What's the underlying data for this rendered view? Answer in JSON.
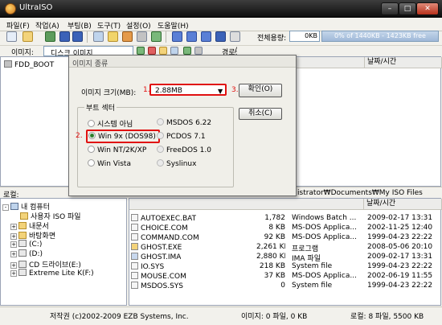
{
  "app": {
    "title": "UltraISO"
  },
  "window_buttons": {
    "min": "–",
    "max": "□",
    "close": "✕"
  },
  "menu": [
    "파일(F)",
    "작업(A)",
    "부팅(B)",
    "도구(T)",
    "설정(O)",
    "도움말(H)"
  ],
  "toolbar": {
    "capacity_label": "전체용량:",
    "capacity_value": "0KB",
    "capacity_bar_text": "0% of 1440KB - 1423KB free"
  },
  "image_row": {
    "label": "이미지:",
    "type": "디스크 이미지",
    "path_label": "경로:",
    "path_value": "/"
  },
  "upper_left": {
    "root": "FDD_BOOT"
  },
  "upper_right": {
    "col_date": "날짜/시간"
  },
  "lower_bar": {
    "label": "로컬:",
    "path": "istrator₩Documents₩My ISO Files"
  },
  "tree": [
    {
      "label": "내 컴퓨터",
      "indent": 0,
      "type": "pc",
      "expander": "-"
    },
    {
      "label": "사용자 ISO 파일",
      "indent": 1,
      "type": "folder",
      "expander": ""
    },
    {
      "label": "내문서",
      "indent": 1,
      "type": "folder",
      "expander": "+"
    },
    {
      "label": "바탕화면",
      "indent": 1,
      "type": "folder",
      "expander": "+"
    },
    {
      "label": "(C:)",
      "indent": 1,
      "type": "drive",
      "expander": "+"
    },
    {
      "label": "(D:)",
      "indent": 1,
      "type": "drive",
      "expander": "+"
    },
    {
      "label": "CD 드라이브(E:)",
      "indent": 1,
      "type": "drive",
      "expander": "+"
    },
    {
      "label": "Extreme Lite K(F:)",
      "indent": 1,
      "type": "drive",
      "expander": "+"
    }
  ],
  "files": {
    "col_date": "날짜/시간",
    "rows": [
      {
        "name": "AUTOEXEC.BAT",
        "size": "1,782",
        "type": "Windows Batch ...",
        "date": "2009-02-17 13:31"
      },
      {
        "name": "CHOICE.COM",
        "size": "8 KB",
        "type": "MS-DOS Applica...",
        "date": "2002-11-25 12:40"
      },
      {
        "name": "COMMAND.COM",
        "size": "92 KB",
        "type": "MS-DOS Applica...",
        "date": "1999-04-23 22:22"
      },
      {
        "name": "GHOST.EXE",
        "size": "2,261 KB",
        "type": "프로그램",
        "date": "2008-05-06 20:10"
      },
      {
        "name": "GHOST.IMA",
        "size": "2,880 KB",
        "type": "IMA 파일",
        "date": "2009-02-17 13:31"
      },
      {
        "name": "IO.SYS",
        "size": "218 KB",
        "type": "System file",
        "date": "1999-04-23 22:22"
      },
      {
        "name": "MOUSE.COM",
        "size": "37 KB",
        "type": "MS-DOS Applica...",
        "date": "2002-06-19 11:55"
      },
      {
        "name": "MSDOS.SYS",
        "size": "0",
        "type": "System file",
        "date": "1999-04-23 22:22"
      }
    ]
  },
  "status": {
    "copyright": "저작권 (c)2002-2009 EZB Systems, Inc.",
    "image_info": "이미지: 0 파일, 0 KB",
    "local_info": "로컬: 8 파일, 5500 KB"
  },
  "dialog": {
    "title": "이미지 종류",
    "size_label": "이미지 크기(MB):",
    "size_value": "2.88MB",
    "step1": "1.",
    "step2": "2.",
    "step3": "3.",
    "ok_label": "확인(O)",
    "cancel_label": "취소(C)",
    "group_title": "부트 섹터",
    "radios": [
      {
        "label": "시스템 아님",
        "checked": false
      },
      {
        "label": "MSDOS 6.22",
        "checked": false
      },
      {
        "label": "Win 9x (DOS98)",
        "checked": true
      },
      {
        "label": "PCDOS 7.1",
        "checked": false
      },
      {
        "label": "Win NT/2K/XP",
        "checked": false
      },
      {
        "label": "FreeDOS 1.0",
        "checked": false
      },
      {
        "label": "Win Vista",
        "checked": false
      },
      {
        "label": "Syslinux",
        "checked": false
      }
    ]
  },
  "colors": {
    "highlight_red": "#e01010",
    "title_bar": "#1a1a1a"
  }
}
